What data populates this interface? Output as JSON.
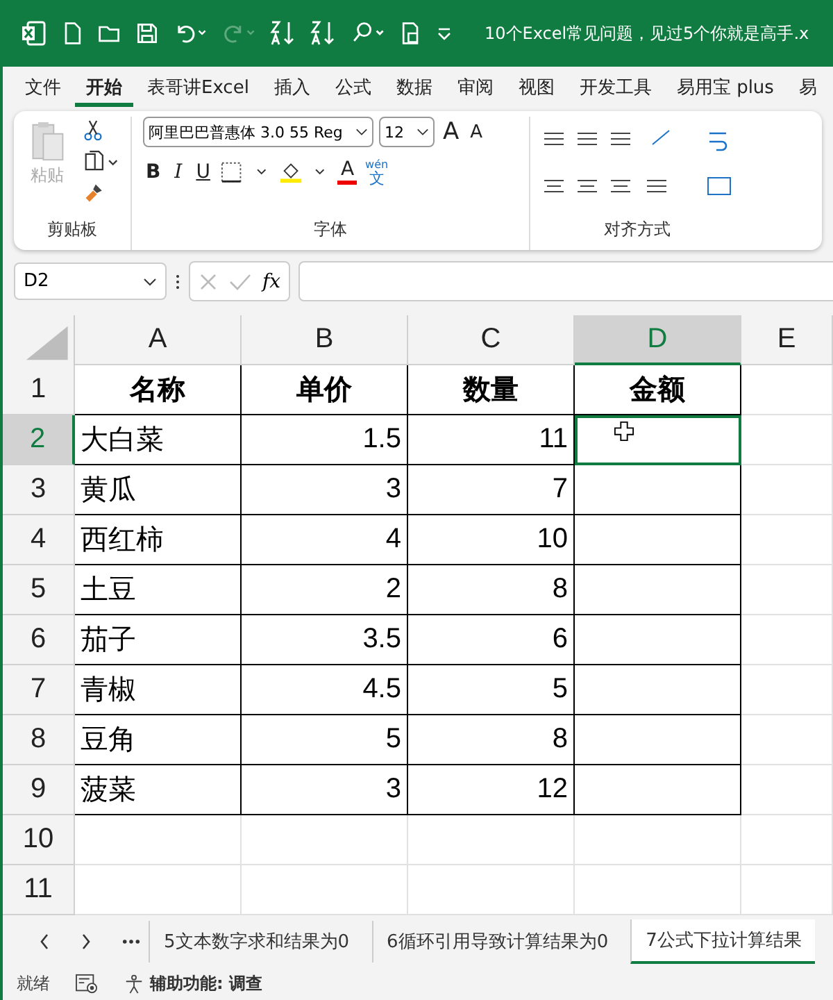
{
  "title_bar": {
    "title": "10个Excel常见问题，见过5个你就是高手.x"
  },
  "ribbon_tabs": [
    {
      "label": "文件",
      "selected": false
    },
    {
      "label": "开始",
      "selected": true
    },
    {
      "label": "表哥讲Excel",
      "selected": false
    },
    {
      "label": "插入",
      "selected": false
    },
    {
      "label": "公式",
      "selected": false
    },
    {
      "label": "数据",
      "selected": false
    },
    {
      "label": "审阅",
      "selected": false
    },
    {
      "label": "视图",
      "selected": false
    },
    {
      "label": "开发工具",
      "selected": false
    },
    {
      "label": "易用宝 plus",
      "selected": false
    },
    {
      "label": "易",
      "selected": false
    }
  ],
  "ribbon": {
    "clipboard": {
      "paste_label": "粘贴",
      "paste_disabled": true,
      "group_label": "剪贴板"
    },
    "font": {
      "font_name": "阿里巴巴普惠体 3.0 55 Reg",
      "font_size": "12",
      "grow": "A",
      "shrink": "A",
      "bold": "B",
      "italic": "I",
      "underline": "U",
      "font_color": "A",
      "phonetic_top": "wén",
      "phonetic_bottom": "文",
      "group_label": "字体"
    },
    "alignment": {
      "group_label": "对齐方式"
    }
  },
  "formula_bar": {
    "name_box": "D2",
    "fx": "fx"
  },
  "sheet": {
    "columns": [
      {
        "label": "A",
        "kind": "text",
        "selected": false
      },
      {
        "label": "B",
        "kind": "number",
        "selected": false
      },
      {
        "label": "C",
        "kind": "number",
        "selected": false
      },
      {
        "label": "D",
        "kind": "number",
        "selected": true
      },
      {
        "label": "E",
        "kind": "text",
        "selected": false
      }
    ],
    "rows": [
      {
        "label": "1",
        "kind": "header",
        "selected": false,
        "cells": [
          "名称",
          "单价",
          "数量",
          "金额"
        ]
      },
      {
        "label": "2",
        "kind": "data",
        "selected": true,
        "cells": [
          "大白菜",
          "1.5",
          "11"
        ]
      },
      {
        "label": "3",
        "kind": "data",
        "selected": false,
        "cells": [
          "黄瓜",
          "3",
          "7"
        ]
      },
      {
        "label": "4",
        "kind": "data",
        "selected": false,
        "cells": [
          "西红柿",
          "4",
          "10"
        ]
      },
      {
        "label": "5",
        "kind": "data",
        "selected": false,
        "cells": [
          "土豆",
          "2",
          "8"
        ]
      },
      {
        "label": "6",
        "kind": "data",
        "selected": false,
        "cells": [
          "茄子",
          "3.5",
          "6"
        ]
      },
      {
        "label": "7",
        "kind": "data",
        "selected": false,
        "cells": [
          "青椒",
          "4.5",
          "5"
        ]
      },
      {
        "label": "8",
        "kind": "data",
        "selected": false,
        "cells": [
          "豆角",
          "5",
          "8"
        ]
      },
      {
        "label": "9",
        "kind": "data",
        "selected": false,
        "cells": [
          "菠菜",
          "3",
          "12"
        ]
      },
      {
        "label": "10",
        "kind": "empty",
        "selected": false,
        "cells": []
      },
      {
        "label": "11",
        "kind": "empty",
        "selected": false,
        "cells": []
      }
    ]
  },
  "sheet_tabs": [
    {
      "label": "5文本数字求和结果为0",
      "selected": false
    },
    {
      "label": "6循环引用导致计算结果为0",
      "selected": false
    },
    {
      "label": "7公式下拉计算结果",
      "selected": true
    }
  ],
  "status_bar": {
    "ready": "就绪",
    "accessibility": "辅助功能: 调查"
  }
}
